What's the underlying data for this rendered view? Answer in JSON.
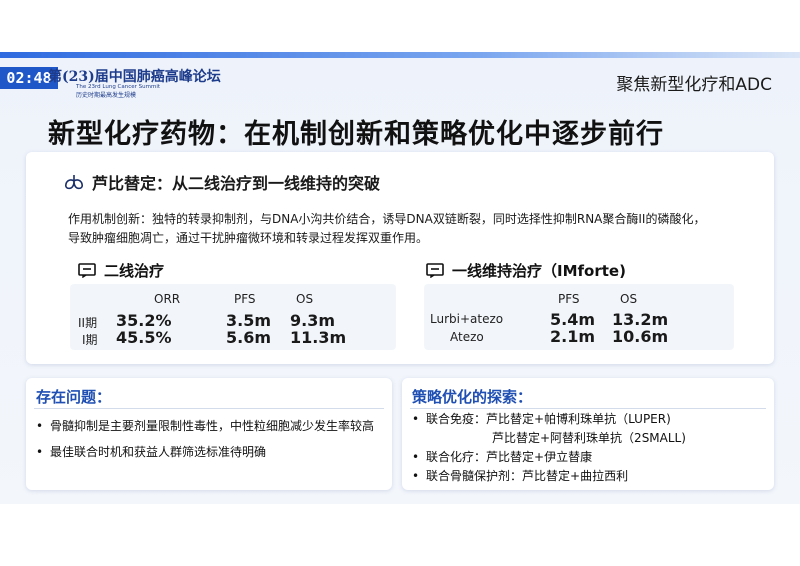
{
  "overlay": {
    "time": "02:48"
  },
  "logo": {
    "main": "第(23)届中国肺癌高峰论坛",
    "en": "The 23rd Lung Cancer Summit",
    "sub": "历史时期最高发生规模"
  },
  "header": {
    "corner_label": "聚焦新型化疗和ADC",
    "title": "新型化疗药物：在机制创新和策略优化中逐步前行"
  },
  "main_card": {
    "heading": "芦比替定：从二线治疗到一线维持的突破",
    "mechanism": "作用机制创新：独特的转录抑制剂，与DNA小沟共价结合，诱导DNA双链断裂，同时选择性抑制RNA聚合酶II的磷酸化，导致肿瘤细胞凋亡，通过干扰肿瘤微环境和转录过程发挥双重作用。",
    "second_line": {
      "title": "二线治疗",
      "headers": [
        "ORR",
        "PFS",
        "OS"
      ],
      "rows": [
        {
          "label": "II期",
          "values": [
            "35.2%",
            "3.5m",
            "9.3m"
          ]
        },
        {
          "label": "I期",
          "values": [
            "45.5%",
            "5.6m",
            "11.3m"
          ]
        }
      ]
    },
    "first_line": {
      "title": "一线维持治疗（IMforte)",
      "headers": [
        "PFS",
        "OS"
      ],
      "rows": [
        {
          "label": "Lurbi+atezo",
          "values": [
            "5.4m",
            "13.2m"
          ]
        },
        {
          "label": "Atezo",
          "values": [
            "2.1m",
            "10.6m"
          ]
        }
      ]
    }
  },
  "problems": {
    "title": "存在问题：",
    "items": [
      "骨髓抑制是主要剂量限制性毒性，中性粒细胞减少发生率较高",
      "最佳联合时机和获益人群筛选标准待明确"
    ]
  },
  "strategy": {
    "title": "策略优化的探索：",
    "items": [
      {
        "label": "联合免疫：",
        "lines": [
          "芦比替定+帕博利珠单抗（LUPER)",
          "芦比替定+阿替利珠单抗（2SMALL)"
        ]
      },
      {
        "label": "联合化疗：",
        "lines": [
          "芦比替定+伊立替康"
        ]
      },
      {
        "label": "联合骨髓保护剂：",
        "lines": [
          "芦比替定+曲拉西利"
        ]
      }
    ]
  },
  "colors": {
    "accent": "#1f4fb3",
    "badge": "#1f57c9",
    "bg": "#eef3fb"
  }
}
